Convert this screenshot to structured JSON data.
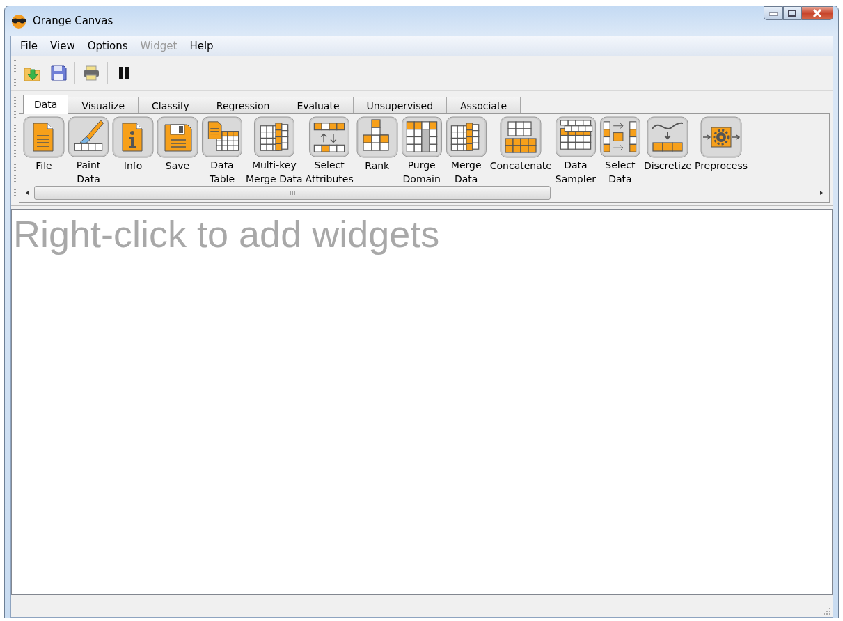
{
  "window": {
    "title": "Orange Canvas"
  },
  "menu": [
    {
      "label": "File",
      "disabled": false
    },
    {
      "label": "View",
      "disabled": false
    },
    {
      "label": "Options",
      "disabled": false
    },
    {
      "label": "Widget",
      "disabled": true
    },
    {
      "label": "Help",
      "disabled": false
    }
  ],
  "tabs": [
    {
      "label": "Data",
      "selected": true
    },
    {
      "label": "Visualize",
      "selected": false
    },
    {
      "label": "Classify",
      "selected": false
    },
    {
      "label": "Regression",
      "selected": false
    },
    {
      "label": "Evaluate",
      "selected": false
    },
    {
      "label": "Unsupervised",
      "selected": false
    },
    {
      "label": "Associate",
      "selected": false
    }
  ],
  "widgets": [
    {
      "label": "File"
    },
    {
      "label": "Paint\nData"
    },
    {
      "label": "Info"
    },
    {
      "label": "Save"
    },
    {
      "label": "Data\nTable"
    },
    {
      "label": "Multi-key\nMerge Data"
    },
    {
      "label": "Select\nAttributes"
    },
    {
      "label": "Rank"
    },
    {
      "label": "Purge\nDomain"
    },
    {
      "label": "Merge\nData"
    },
    {
      "label": "Concatenate"
    },
    {
      "label": "Data\nSampler"
    },
    {
      "label": "Select\nData"
    },
    {
      "label": "Discretize"
    },
    {
      "label": "Preprocess"
    }
  ],
  "canvas": {
    "placeholder": "Right-click to add widgets"
  }
}
